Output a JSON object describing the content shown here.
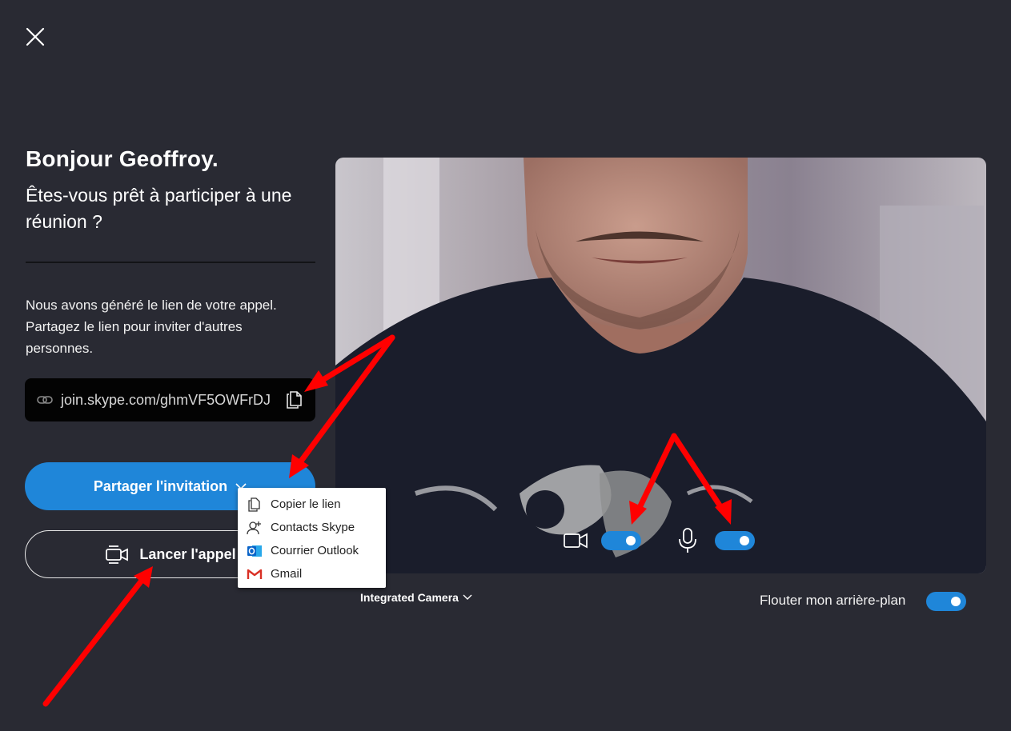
{
  "greeting": "Bonjour Geoffroy.",
  "question": "Êtes-vous prêt à participer à une réunion ?",
  "info_text": "Nous avons généré le lien de votre appel. Partagez le lien pour inviter d'autres personnes.",
  "link": {
    "url": "join.skype.com/ghmVF5OWFrDJ",
    "icon": "link-icon",
    "copy_icon": "copy-icon"
  },
  "buttons": {
    "share_label": "Partager l'invitation",
    "call_label": "Lancer l'appel"
  },
  "share_menu": [
    {
      "label": "Copier le lien",
      "icon": "copy-icon"
    },
    {
      "label": "Contacts Skype",
      "icon": "add-contact-icon"
    },
    {
      "label": "Courrier Outlook",
      "icon": "outlook-icon"
    },
    {
      "label": "Gmail",
      "icon": "gmail-icon"
    }
  ],
  "preview": {
    "camera_on": true,
    "mic_on": true,
    "camera_device": "Integrated Camera",
    "blur_label": "Flouter mon arrière-plan",
    "blur_on": true
  },
  "colors": {
    "background": "#292a33",
    "accent": "#1f86d9",
    "link_box": "#030303",
    "annotation_arrow": "#ff0000"
  }
}
